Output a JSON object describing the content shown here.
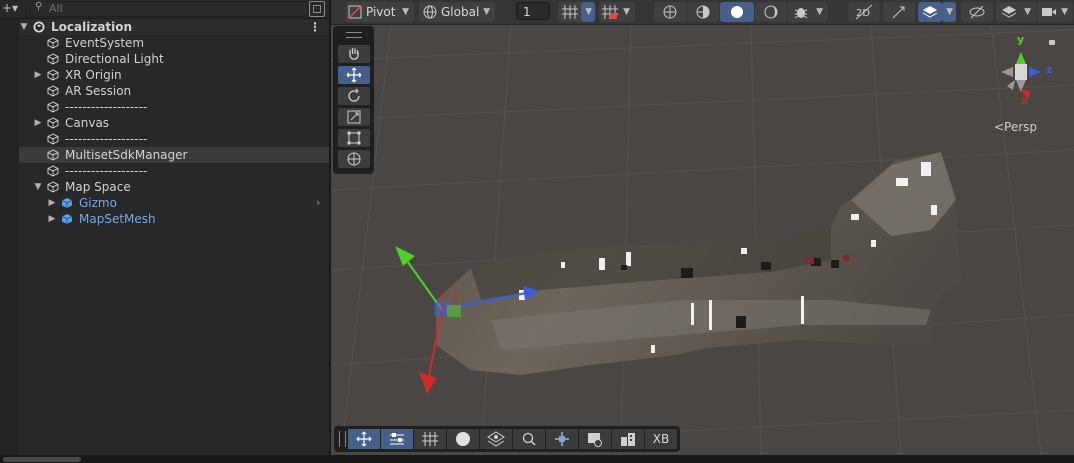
{
  "hierarchy": {
    "add_icon": "plus-icon",
    "search_placeholder": "All",
    "scene_name": "Localization",
    "items": [
      {
        "label": "EventSystem",
        "expandable": false,
        "selected": false,
        "prefab": false
      },
      {
        "label": "Directional Light",
        "expandable": false,
        "selected": false,
        "prefab": false
      },
      {
        "label": "XR Origin",
        "expandable": true,
        "selected": false,
        "prefab": false
      },
      {
        "label": "AR Session",
        "expandable": false,
        "selected": false,
        "prefab": false
      },
      {
        "label": "-------------------",
        "expandable": false,
        "selected": false,
        "prefab": false
      },
      {
        "label": "Canvas",
        "expandable": true,
        "selected": false,
        "prefab": false
      },
      {
        "label": "-------------------",
        "expandable": false,
        "selected": false,
        "prefab": false
      },
      {
        "label": "MultisetSdkManager",
        "expandable": false,
        "selected": true,
        "prefab": false
      },
      {
        "label": "-------------------",
        "expandable": false,
        "selected": false,
        "prefab": false
      },
      {
        "label": "Map Space",
        "expandable": true,
        "expanded": true,
        "selected": false,
        "prefab": false
      },
      {
        "label": "Gizmo",
        "expandable": true,
        "selected": false,
        "prefab": true,
        "child": true
      },
      {
        "label": "MapSetMesh",
        "expandable": true,
        "selected": false,
        "prefab": true,
        "child": true
      }
    ]
  },
  "scene_toolbar": {
    "pivot_label": "Pivot",
    "global_label": "Global",
    "grid_value": "1"
  },
  "orientation_gizmo": {
    "y_label": "y",
    "z_label": "z",
    "x_label": "x",
    "persp_label": "<Persp"
  },
  "overlay_bar": {
    "xb_label": "XB"
  },
  "colors": {
    "selection_blue": "#45618a",
    "prefab_blue": "#7aa7e8",
    "axis_x": "#d02a2a",
    "axis_y": "#4fcf2a",
    "axis_z": "#3a5ee0"
  }
}
